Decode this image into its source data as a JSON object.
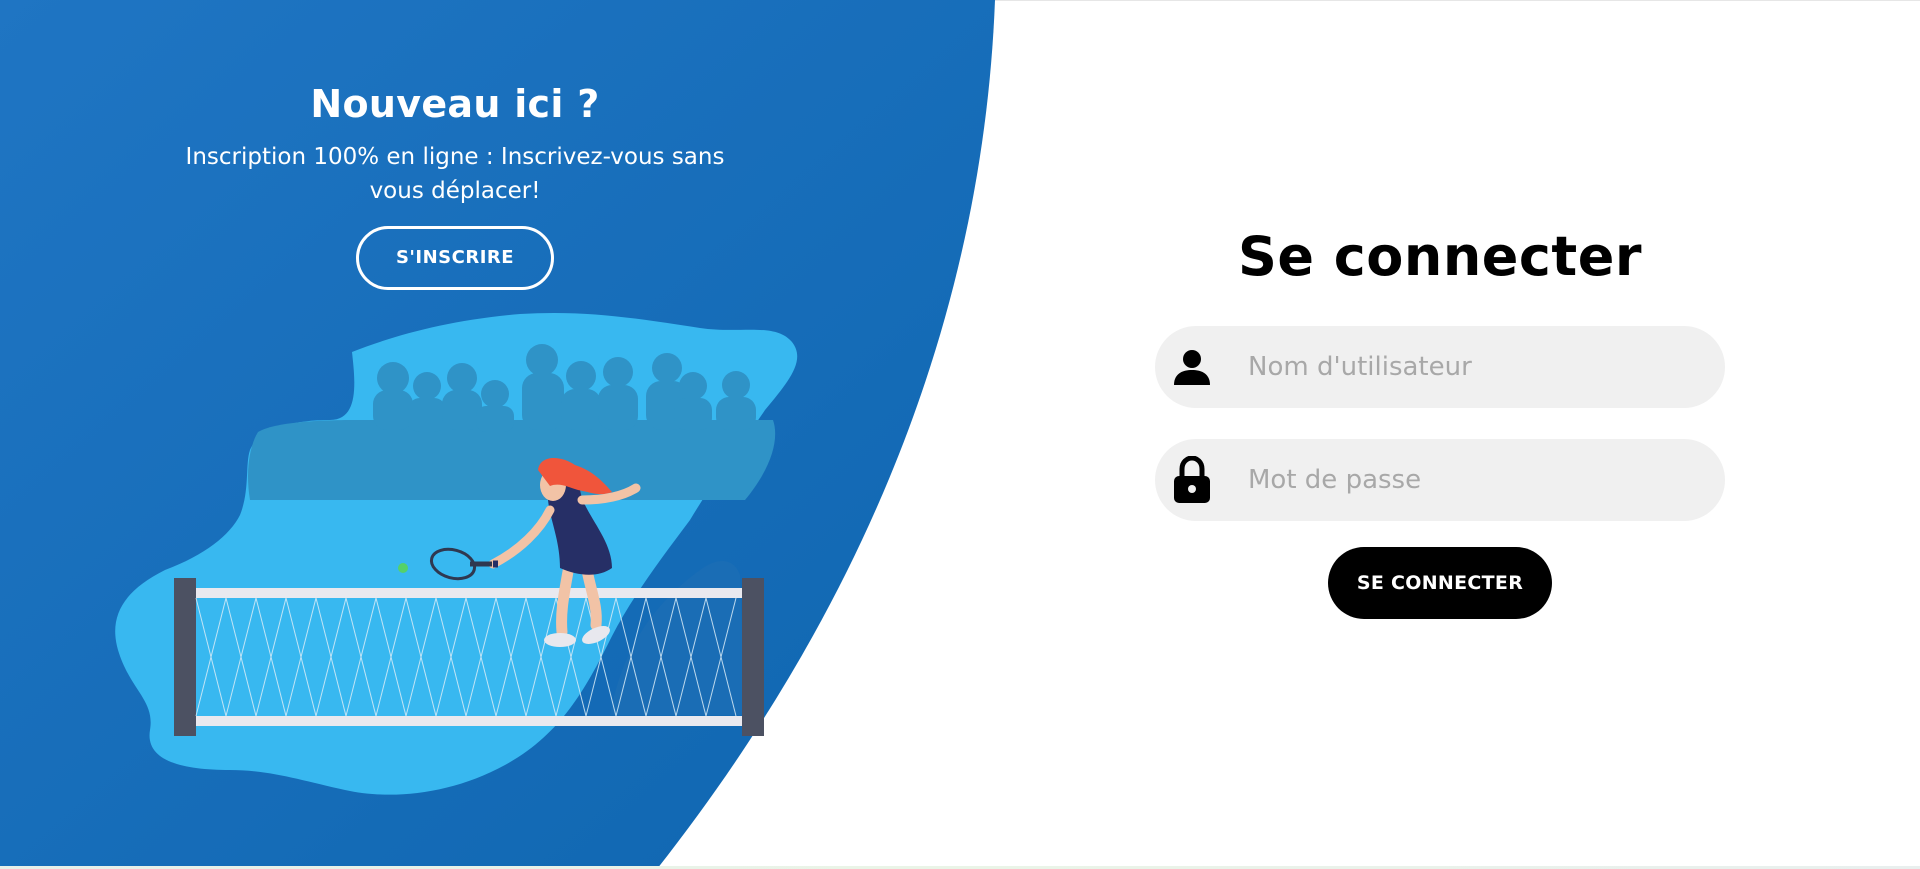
{
  "signup_panel": {
    "title": "Nouveau ici ?",
    "text": "Inscription 100% en ligne : Inscrivez-vous sans vous déplacer!",
    "button_label": "S'INSCRIRE"
  },
  "login_form": {
    "title": "Se connecter",
    "username": {
      "placeholder": "Nom d'utilisateur",
      "value": "",
      "icon": "user-icon"
    },
    "password": {
      "placeholder": "Mot de passe",
      "value": "",
      "icon": "lock-icon"
    },
    "button_label": "SE CONNECTER"
  },
  "colors": {
    "panel_blue": "#1a72bf",
    "panel_blue_dark": "#0f67b2",
    "illustration_light_blue": "#38b8f0",
    "field_bg": "#f0f0f0",
    "button_black": "#000000"
  }
}
